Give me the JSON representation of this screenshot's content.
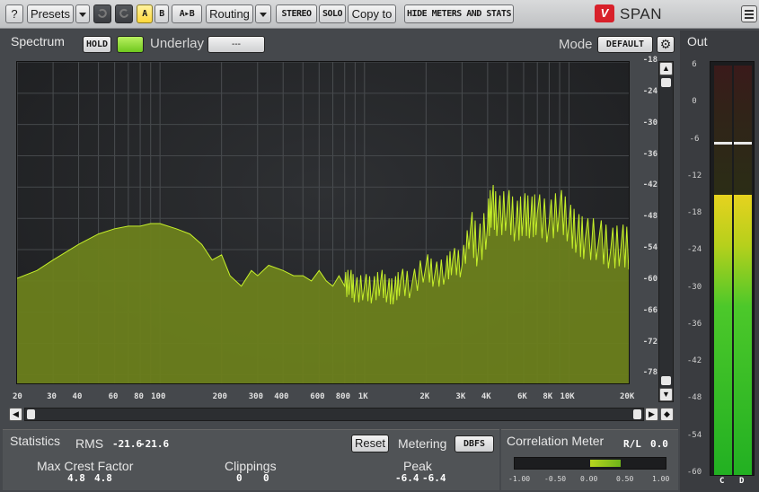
{
  "toolbar": {
    "help": "?",
    "presets": "Presets",
    "ab_a": "A",
    "ab_b": "B",
    "ab_copy": "A▸B",
    "routing": "Routing",
    "stereo": "STEREO",
    "solo": "SOLO",
    "copy_to": "Copy to",
    "hide_meters": "HIDE METERS AND STATS",
    "logo_mark": "V",
    "app_name": "SPAN"
  },
  "spectrum": {
    "title": "Spectrum",
    "hold": "HOLD",
    "underlay_label": "Underlay",
    "underlay_value": "---",
    "mode_label": "Mode",
    "mode_value": "DEFAULT",
    "db_ticks": [
      "-18",
      "-24",
      "-30",
      "-36",
      "-42",
      "-48",
      "-54",
      "-60",
      "-66",
      "-72",
      "-78"
    ],
    "freq_ticks": [
      "20",
      "30",
      "40",
      "60",
      "80",
      "100",
      "200",
      "300",
      "400",
      "600",
      "800",
      "1K",
      "2K",
      "3K",
      "4K",
      "6K",
      "8K",
      "10K",
      "20K"
    ],
    "fill_color": "#6b7f1c",
    "line_color": "#c6f02a"
  },
  "chart_data": {
    "type": "area",
    "xscale": "log",
    "xlim": [
      20,
      20000
    ],
    "ylim": [
      -80,
      -18
    ],
    "x": [
      20,
      25,
      30,
      40,
      50,
      60,
      70,
      80,
      90,
      100,
      120,
      140,
      160,
      180,
      200,
      220,
      250,
      280,
      300,
      340,
      400,
      450,
      500,
      550,
      600,
      650,
      700,
      750,
      800,
      850,
      900,
      1000,
      1100,
      1200,
      1300,
      1400,
      1500,
      1700,
      2000,
      2200,
      2500,
      2700,
      3000,
      3300,
      3600,
      4000,
      4200,
      4500,
      5000,
      5500,
      6000,
      6500,
      7000,
      8000,
      9000,
      10000,
      11000,
      12000,
      14000,
      16000,
      18000,
      20000
    ],
    "values": [
      -59.5,
      -58,
      -56,
      -53,
      -51,
      -50,
      -49.5,
      -49.5,
      -49,
      -49,
      -50,
      -51,
      -53,
      -56,
      -55,
      -59,
      -61,
      -58,
      -59,
      -57,
      -58,
      -59,
      -59,
      -60,
      -58,
      -60,
      -61,
      -59,
      -61,
      -60,
      -62,
      -61,
      -62,
      -60,
      -62,
      -62,
      -60,
      -61,
      -57,
      -59,
      -58,
      -56,
      -57,
      -50,
      -54,
      -49,
      -45,
      -48,
      -46,
      -49,
      -47,
      -48,
      -47,
      -49,
      -46,
      -49,
      -51,
      -52,
      -52,
      -54,
      -53,
      -54
    ]
  },
  "hscroll": {
    "left": "◀",
    "right": "▶",
    "far": "◆"
  },
  "vscroll": {
    "up": "▲",
    "down": "▼"
  },
  "statistics": {
    "title": "Statistics",
    "rms_label": "RMS",
    "rms_l": "-21.6",
    "rms_r": "-21.6",
    "reset": "Reset",
    "metering_label": "Metering",
    "metering_value": "DBFS",
    "crest_label": "Max Crest Factor",
    "crest_l": "4.8",
    "crest_r": "4.8",
    "clip_label": "Clippings",
    "clip_l": "0",
    "clip_r": "0",
    "peak_label": "Peak",
    "peak_l": "-6.4",
    "peak_r": "-6.4"
  },
  "correlation": {
    "title": "Correlation Meter",
    "rl_label": "R/L",
    "rl_value": "0.0",
    "scale": [
      "-1.00",
      "-0.50",
      "0.00",
      "0.50",
      "1.00"
    ],
    "value": 0.4
  },
  "output": {
    "title": "Out",
    "scale": [
      "6",
      "0",
      "-6",
      "-12",
      "-18",
      "-24",
      "-30",
      "-36",
      "-42",
      "-48",
      "-54",
      "-60"
    ],
    "ch_left": "C",
    "ch_right": "D",
    "level_db": -15,
    "peak_db": -6.4
  }
}
